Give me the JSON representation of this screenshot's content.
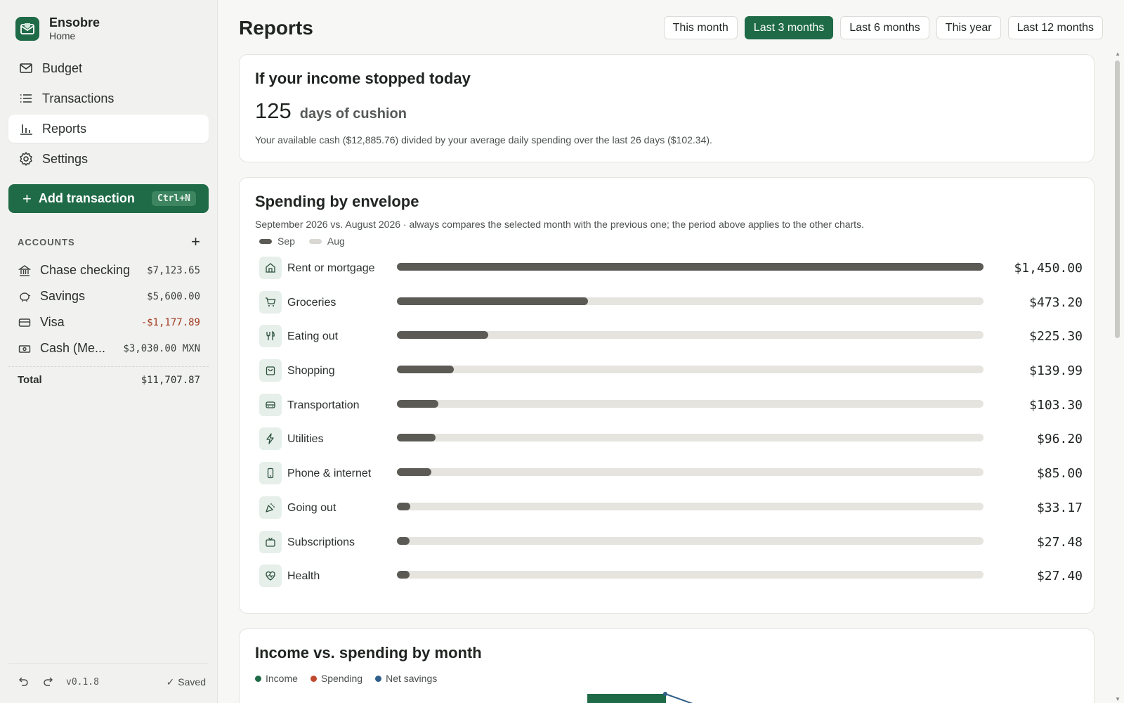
{
  "brand": {
    "name": "Ensobre",
    "subtitle": "Home"
  },
  "nav": [
    {
      "label": "Budget",
      "icon": "envelope-icon",
      "active": false
    },
    {
      "label": "Transactions",
      "icon": "list-icon",
      "active": false
    },
    {
      "label": "Reports",
      "icon": "bar-chart-icon",
      "active": true
    },
    {
      "label": "Settings",
      "icon": "gear-icon",
      "active": false
    }
  ],
  "add_transaction": {
    "label": "Add transaction",
    "shortcut": "Ctrl+N"
  },
  "accounts": {
    "title": "ACCOUNTS",
    "items": [
      {
        "name": "Chase checking",
        "balance": "$7,123.65",
        "icon": "bank-icon",
        "negative": false
      },
      {
        "name": "Savings",
        "balance": "$5,600.00",
        "icon": "piggy-bank-icon",
        "negative": false
      },
      {
        "name": "Visa",
        "balance": "-$1,177.89",
        "icon": "credit-card-icon",
        "negative": true
      },
      {
        "name": "Cash (Me...",
        "balance": "$3,030.00 MXN",
        "icon": "cash-icon",
        "negative": false
      }
    ],
    "total_label": "Total",
    "total_value": "$11,707.87"
  },
  "footer": {
    "version": "v0.1.8",
    "status": "Saved"
  },
  "page": {
    "title": "Reports"
  },
  "periods": [
    {
      "label": "This month",
      "active": false
    },
    {
      "label": "Last 3 months",
      "active": true
    },
    {
      "label": "Last 6 months",
      "active": false
    },
    {
      "label": "This year",
      "active": false
    },
    {
      "label": "Last 12 months",
      "active": false
    }
  ],
  "cushion_card": {
    "title": "If your income stopped today",
    "days": "125",
    "days_label": "days of cushion",
    "description": "Your available cash ($12,885.76) divided by your average daily spending over the last 26 days ($102.34)."
  },
  "envelope_card": {
    "title": "Spending by envelope",
    "subtitle": "September 2026 vs. August 2026 · always compares the selected month with the previous one; the period above applies to the other charts.",
    "legend": [
      {
        "label": "Sep",
        "color": "#5c5a55"
      },
      {
        "label": "Aug",
        "color": "#d9d7d2"
      }
    ],
    "max": 1450.0,
    "rows": [
      {
        "label": "Rent or mortgage",
        "icon": "house-icon",
        "value": 1450.0,
        "amount": "$1,450.00"
      },
      {
        "label": "Groceries",
        "icon": "cart-icon",
        "value": 473.2,
        "amount": "$473.20"
      },
      {
        "label": "Eating out",
        "icon": "utensils-icon",
        "value": 225.3,
        "amount": "$225.30"
      },
      {
        "label": "Shopping",
        "icon": "shopping-bag-icon",
        "value": 139.99,
        "amount": "$139.99"
      },
      {
        "label": "Transportation",
        "icon": "bus-icon",
        "value": 103.3,
        "amount": "$103.30"
      },
      {
        "label": "Utilities",
        "icon": "bolt-icon",
        "value": 96.2,
        "amount": "$96.20"
      },
      {
        "label": "Phone & internet",
        "icon": "phone-icon",
        "value": 85.0,
        "amount": "$85.00"
      },
      {
        "label": "Going out",
        "icon": "party-icon",
        "value": 33.17,
        "amount": "$33.17"
      },
      {
        "label": "Subscriptions",
        "icon": "tv-icon",
        "value": 27.48,
        "amount": "$27.48"
      },
      {
        "label": "Health",
        "icon": "heart-pulse-icon",
        "value": 27.4,
        "amount": "$27.40"
      }
    ]
  },
  "income_card": {
    "title": "Income vs. spending by month",
    "legend": [
      {
        "label": "Income",
        "color": "#1f6b47"
      },
      {
        "label": "Spending",
        "color": "#c0492f"
      },
      {
        "label": "Net savings",
        "color": "#2f5f8a"
      }
    ]
  },
  "colors": {
    "accent": "#1f6b47",
    "bar_fill": "#5c5a55",
    "bar_track": "#e6e4df",
    "negative": "#a2391f"
  }
}
